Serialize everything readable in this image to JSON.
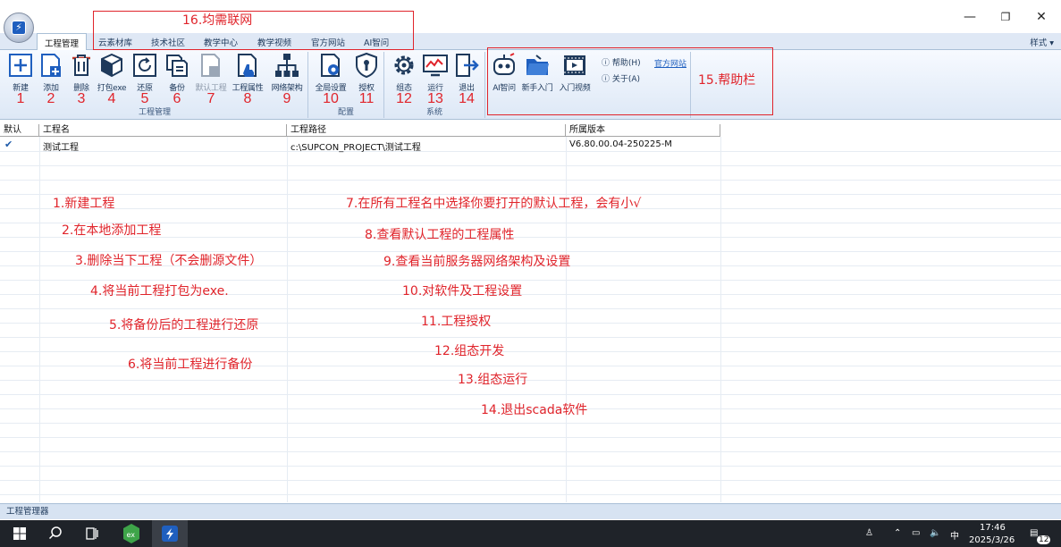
{
  "window": {
    "minimize_glyph": "—",
    "restore_glyph": "❐",
    "close_glyph": "✕"
  },
  "tabs": [
    {
      "label": "工程管理"
    },
    {
      "label": "云素材库"
    },
    {
      "label": "技术社区"
    },
    {
      "label": "教学中心"
    },
    {
      "label": "教学视频"
    },
    {
      "label": "官方网站"
    },
    {
      "label": "AI智问"
    }
  ],
  "style_menu": "样式 ▾",
  "ribbon": {
    "groups": [
      {
        "label": "工程管理"
      },
      {
        "label": "配置"
      },
      {
        "label": "系统"
      }
    ],
    "buttons": [
      {
        "label": "新建",
        "num": "1"
      },
      {
        "label": "添加",
        "num": "2"
      },
      {
        "label": "删除",
        "num": "3"
      },
      {
        "label": "打包exe",
        "num": "4"
      },
      {
        "label": "还原",
        "num": "5"
      },
      {
        "label": "备份",
        "num": "6"
      },
      {
        "label": "默认工程",
        "num": "7"
      },
      {
        "label": "工程属性",
        "num": "8"
      },
      {
        "label": "网络架构",
        "num": "9"
      },
      {
        "label": "全局设置",
        "num": "10"
      },
      {
        "label": "授权",
        "num": "11"
      },
      {
        "label": "组态",
        "num": "12"
      },
      {
        "label": "运行",
        "num": "13"
      },
      {
        "label": "退出",
        "num": "14"
      },
      {
        "label": "AI智问"
      },
      {
        "label": "新手入门"
      },
      {
        "label": "入门视频"
      }
    ],
    "help": "帮助(H)",
    "about": "关于(A)",
    "official_site": "官方网站"
  },
  "annotations": {
    "tabs_box": "16.均需联网",
    "help_box": "15.帮助栏"
  },
  "table": {
    "columns": [
      "默认",
      "工程名",
      "工程路径",
      "所属版本"
    ],
    "rows": [
      {
        "default": "✔",
        "name": "测试工程",
        "path": "c:\\SUPCON_PROJECT\\测试工程",
        "version": "V6.80.00.04-250225-M"
      }
    ]
  },
  "notes": [
    "1.新建工程",
    "2.在本地添加工程",
    "3.删除当下工程（不会删源文件）",
    "4.将当前工程打包为exe.",
    "5.将备份后的工程进行还原",
    "6.将当前工程进行备份",
    "7.在所有工程名中选择你要打开的默认工程，会有小√",
    "8.查看默认工程的工程属性",
    "9.查看当前服务器网络架构及设置",
    "10.对软件及工程设置",
    "11.工程授权",
    "12.组态开发",
    "13.组态运行",
    "14.退出scada软件"
  ],
  "status": "工程管理器",
  "taskbar": {
    "time": "17:46",
    "date": "2025/3/26",
    "ime": "中",
    "notif_count": "12"
  },
  "colors": {
    "annotation_red": "#e0242b",
    "ribbon_blue": "#dfe8f5",
    "taskbar": "#1f2329"
  }
}
